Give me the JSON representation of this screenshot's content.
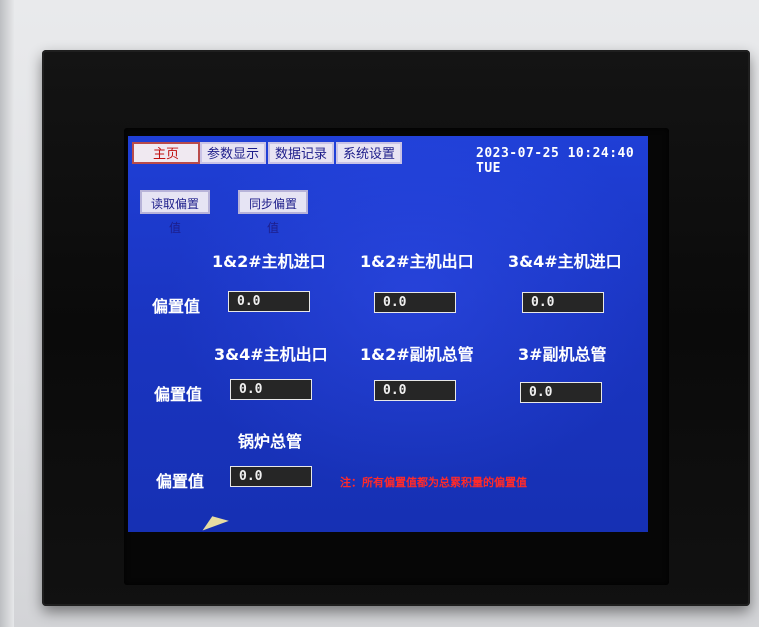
{
  "tabs": [
    "主页",
    "参数显示",
    "数据记录",
    "系统设置"
  ],
  "datetime": "2023-07-25 10:24:40 TUE",
  "buttons": {
    "read_offset": "读取偏置值",
    "sync_offset": "同步偏置值"
  },
  "row_label": "偏置值",
  "groups": [
    {
      "label": "1&2#主机进口",
      "value": "0.0"
    },
    {
      "label": "1&2#主机出口",
      "value": "0.0"
    },
    {
      "label": "3&4#主机进口",
      "value": "0.0"
    },
    {
      "label": "3&4#主机出口",
      "value": "0.0"
    },
    {
      "label": "1&2#副机总管",
      "value": "0.0"
    },
    {
      "label": "3#副机总管",
      "value": "0.0"
    },
    {
      "label": "锅炉总管",
      "value": "0.0"
    }
  ],
  "note": "注：所有偏置值都为总累积量的偏置值",
  "colors": {
    "screen_bg": "#1a35c2",
    "tab_bg": "#e8e4f3",
    "active_tab_text": "#c01010",
    "note_text": "#ff2a2a",
    "field_bg": "#262626"
  }
}
